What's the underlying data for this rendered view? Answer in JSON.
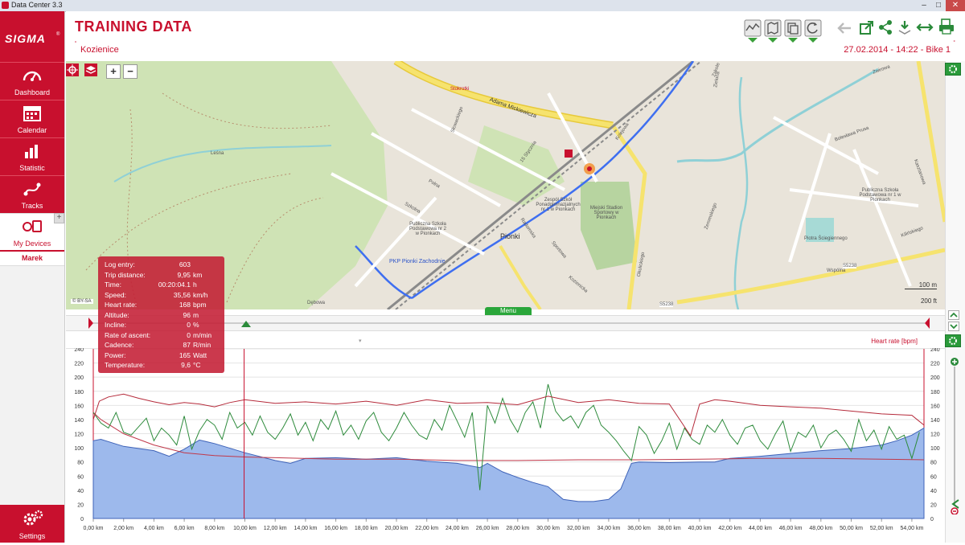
{
  "window": {
    "title": "Data Center 3.3",
    "minimize": "–",
    "maximize": "□",
    "close": "✕"
  },
  "sidebar": {
    "brand": "SIGMA",
    "brand_mark": "®",
    "items": [
      {
        "label": "Dashboard",
        "icon": "gauge-icon"
      },
      {
        "label": "Calendar",
        "icon": "calendar-icon"
      },
      {
        "label": "Statistic",
        "icon": "bar-chart-icon"
      },
      {
        "label": "Tracks",
        "icon": "route-icon"
      },
      {
        "label": "My Devices",
        "icon": "devices-icon"
      }
    ],
    "add": "+",
    "user": "Marek",
    "settings": "Settings"
  },
  "header": {
    "title": "TRAINING DATA",
    "location": "Kozienice",
    "location_mark": "˚",
    "session": "27.02.2014 - 14:22 - Bike 1",
    "session_mark": "˚"
  },
  "map": {
    "zoom_in": "+",
    "zoom_out": "−",
    "scale_m": "100 m",
    "scale_ft": "200 ft",
    "credit": "© BY-SA",
    "labels": [
      "Adama Mickiewicza",
      "Pionki",
      "PKP Pionki Zachodnie",
      "Zespół Szkół Ponadgimnazjalnych nr 1 w Pionkach",
      "Miejski Stadion Sportowy w Pionkach",
      "Publiczna Szkoła Podstawowa nr 2 w Pionkach",
      "Publiczna Szkoła Podstawowa nr 1 w Pionkach",
      "Piotra Ściegiennego",
      "Wspólna",
      "Kolejowa",
      "Leśna",
      "Zakole",
      "Słowackiego",
      "15 Stycznia",
      "Polna",
      "Radomska",
      "Sportowa",
      "Kozienicka",
      "Szkolna",
      "Stokrotki",
      "Dębowa",
      "Zielona",
      "Bolesława Prusa",
      "Żwirowa",
      "Kasztanowa",
      "Kilińskiego",
      "Okulickiego",
      "Żeromskiego"
    ],
    "road_numbers": [
      "S5238",
      "S5238"
    ],
    "menu_tab": "Menu"
  },
  "info_panel": {
    "rows": [
      {
        "key": "Log entry:",
        "value": "603",
        "unit": ""
      },
      {
        "key": "Trip distance:",
        "value": "9,95",
        "unit": "km"
      },
      {
        "key": "Time:",
        "value": "00:20:04.1",
        "unit": "h"
      },
      {
        "key": "Speed:",
        "value": "35,56",
        "unit": "km/h"
      },
      {
        "key": "Heart rate:",
        "value": "168",
        "unit": "bpm"
      },
      {
        "key": "Altitude:",
        "value": "96",
        "unit": "m"
      },
      {
        "key": "Incline:",
        "value": "0",
        "unit": "%"
      },
      {
        "key": "Rate of ascent:",
        "value": "0",
        "unit": "m/min"
      },
      {
        "key": "Cadence:",
        "value": "87",
        "unit": "R/min"
      },
      {
        "key": "Power:",
        "value": "165",
        "unit": "Watt"
      },
      {
        "key": "Temperature:",
        "value": "9,6",
        "unit": "°C"
      }
    ]
  },
  "chart_header": {
    "right_label": "Heart rate [bpm]",
    "dropdown": "▾"
  },
  "chart_data": {
    "type": "line",
    "x_unit": "km",
    "xlim": [
      0,
      54.8
    ],
    "ylim": [
      0,
      240
    ],
    "y_ticks": [
      0,
      20,
      40,
      60,
      80,
      100,
      120,
      140,
      160,
      180,
      200,
      220,
      240
    ],
    "y_tick_labels_left": [
      "0",
      "20",
      "40",
      "60",
      "80",
      "100",
      "120",
      "140",
      "160",
      "180",
      "200",
      "220",
      "240"
    ],
    "y_tick_labels_right": [
      "0",
      "20",
      "40",
      "60",
      "80",
      "100",
      "120",
      "140",
      "160",
      "180",
      "200",
      "220",
      "240"
    ],
    "x_ticks": [
      0,
      2,
      4,
      6,
      8,
      10,
      12,
      14,
      16,
      18,
      20,
      22,
      24,
      26,
      28,
      30,
      32,
      34,
      36,
      38,
      40,
      42,
      44,
      46,
      48,
      50,
      52,
      54
    ],
    "x_tick_labels": [
      "0,00 km",
      "2,00 km",
      "4,00 km",
      "6,00 km",
      "8,00 km",
      "10,00 km",
      "12,00 km",
      "14,00 km",
      "16,00 km",
      "18,00 km",
      "20,00 km",
      "22,00 km",
      "24,00 km",
      "26,00 km",
      "28,00 km",
      "30,00 km",
      "32,00 km",
      "34,00 km",
      "36,00 km",
      "38,00 km",
      "40,00 km",
      "42,00 km",
      "44,00 km",
      "46,00 km",
      "48,00 km",
      "50,00 km",
      "52,00 km",
      "54,00 km"
    ],
    "cursor_x": 9.95,
    "grid": true,
    "colors": {
      "altitude_fill": "#9db9ec",
      "altitude_line": "#3f63b8",
      "heart_rate": "#b52a3a",
      "speed": "#2e8b3c",
      "temperature": "#c0384a"
    },
    "series": [
      {
        "key": "altitude",
        "kind": "area",
        "x": [
          0,
          0.5,
          2,
          4,
          5,
          6,
          7,
          8,
          10,
          12,
          13,
          14,
          16,
          18,
          20,
          22,
          24,
          25.5,
          26,
          27,
          28,
          29,
          30,
          31,
          32,
          33,
          34,
          34.8,
          35.5,
          36,
          38,
          40,
          41,
          42,
          44,
          46,
          48,
          50,
          52,
          53,
          54,
          54.8
        ],
        "y": [
          110,
          112,
          102,
          96,
          88,
          98,
          111,
          106,
          93,
          82,
          78,
          85,
          86,
          84,
          86,
          81,
          78,
          72,
          78,
          66,
          58,
          51,
          45,
          27,
          24,
          24,
          27,
          42,
          78,
          80,
          79,
          80,
          80,
          85,
          88,
          92,
          96,
          99,
          104,
          110,
          118,
          128
        ]
      },
      {
        "key": "heart_rate",
        "kind": "line",
        "x": [
          0,
          0.4,
          1,
          2,
          3,
          4,
          5,
          6,
          7,
          8,
          9,
          10,
          12,
          14,
          16,
          18,
          20,
          22,
          24,
          26,
          28,
          30,
          32,
          34,
          36,
          38,
          39.4,
          40,
          41,
          42,
          44,
          46,
          48,
          50,
          52,
          54,
          54.8
        ],
        "y": [
          140,
          166,
          172,
          176,
          170,
          165,
          161,
          164,
          162,
          158,
          164,
          168,
          163,
          165,
          162,
          166,
          160,
          168,
          163,
          164,
          161,
          173,
          164,
          168,
          163,
          162,
          117,
          162,
          168,
          166,
          160,
          158,
          156,
          152,
          148,
          146,
          132
        ]
      },
      {
        "key": "speed",
        "kind": "line",
        "x": [
          0,
          0.5,
          1,
          1.5,
          2,
          2.5,
          3,
          3.5,
          4,
          4.5,
          5,
          5.5,
          6,
          6.5,
          7,
          7.5,
          8,
          8.5,
          9,
          9.5,
          10,
          10.5,
          11,
          11.5,
          12,
          12.5,
          13,
          13.5,
          14,
          14.5,
          15,
          15.5,
          16,
          16.5,
          17,
          17.5,
          18,
          18.5,
          19,
          19.5,
          20,
          20.5,
          21,
          21.5,
          22,
          22.5,
          23,
          23.5,
          24,
          24.5,
          25,
          25.5,
          26,
          26.5,
          27,
          27.5,
          28,
          28.5,
          29,
          29.5,
          30,
          30.5,
          31,
          31.5,
          32,
          32.5,
          33,
          33.5,
          34,
          34.5,
          35,
          35.5,
          36,
          36.5,
          37,
          37.5,
          38,
          38.5,
          39,
          39.5,
          40,
          40.5,
          41,
          41.5,
          42,
          42.5,
          43,
          43.5,
          44,
          44.5,
          45,
          45.5,
          46,
          46.5,
          47,
          47.5,
          48,
          48.5,
          49,
          49.5,
          50,
          50.5,
          51,
          51.5,
          52,
          52.5,
          53,
          53.5,
          54,
          54.5
        ],
        "y": [
          150,
          135,
          128,
          150,
          122,
          118,
          130,
          142,
          110,
          128,
          118,
          104,
          145,
          98,
          124,
          140,
          132,
          112,
          150,
          128,
          136,
          118,
          145,
          122,
          112,
          128,
          148,
          118,
          136,
          110,
          140,
          126,
          152,
          118,
          132,
          112,
          138,
          150,
          122,
          110,
          128,
          150,
          132,
          118,
          112,
          140,
          125,
          160,
          138,
          115,
          150,
          40,
          160,
          135,
          170,
          140,
          122,
          150,
          165,
          128,
          190,
          152,
          138,
          145,
          128,
          150,
          160,
          132,
          122,
          110,
          95,
          82,
          130,
          118,
          92,
          110,
          135,
          98,
          128,
          112,
          105,
          132,
          122,
          140,
          118,
          105,
          128,
          132,
          110,
          98,
          120,
          138,
          95,
          122,
          115,
          132,
          100,
          118,
          125,
          112,
          95,
          140,
          110,
          125,
          98,
          130,
          112,
          118,
          85,
          122
        ]
      },
      {
        "key": "temperature",
        "kind": "line",
        "x": [
          0,
          0.5,
          2,
          4,
          6,
          8,
          10,
          12,
          16,
          20,
          24,
          28,
          32,
          36,
          40,
          44,
          48,
          52,
          54.8
        ],
        "y": [
          150,
          140,
          120,
          104,
          93,
          89,
          87,
          86,
          84,
          84,
          82,
          82,
          83,
          83,
          84,
          85,
          85,
          84,
          83
        ]
      }
    ]
  }
}
